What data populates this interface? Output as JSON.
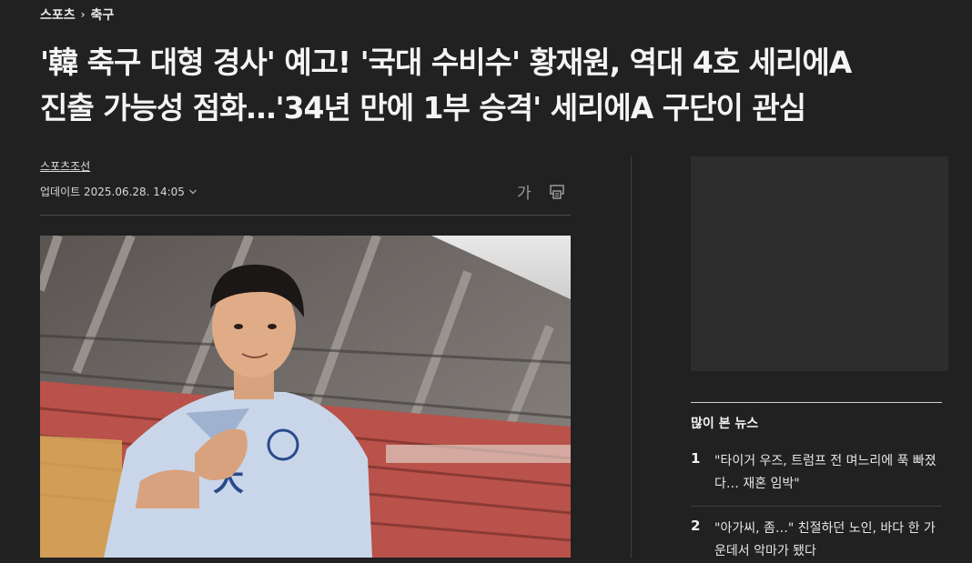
{
  "breadcrumb": {
    "section": "스포츠",
    "separator": "›",
    "category": "축구"
  },
  "article": {
    "title_line1": "'韓 축구 대형 경사' 예고! '국대 수비수' 황재원, 역대 4호 세리에A",
    "title_line2": "진출 가능성 점화…'34년 만에 1부 승격' 세리에A 구단이 관심",
    "source": "스포츠조선",
    "updated": "업데이트 2025.06.28. 14:05",
    "font_size_button": "가"
  },
  "sidebar": {
    "most_viewed_title": "많이 본 뉴스",
    "items": [
      {
        "rank": "1",
        "text": "\"타이거 우즈, 트럼프 전 며느리에 푹 빠졌다… 재혼 임박\""
      },
      {
        "rank": "2",
        "text": "\"아가씨, 좀…\" 친절하던 노인, 바다 한 가운데서 악마가 됐다"
      }
    ]
  },
  "colors": {
    "background": "#212121",
    "text": "#f4f4f4",
    "muted": "#9a9a9a"
  },
  "icons": {
    "chevron": "chevron-down-icon",
    "print": "print-icon"
  }
}
